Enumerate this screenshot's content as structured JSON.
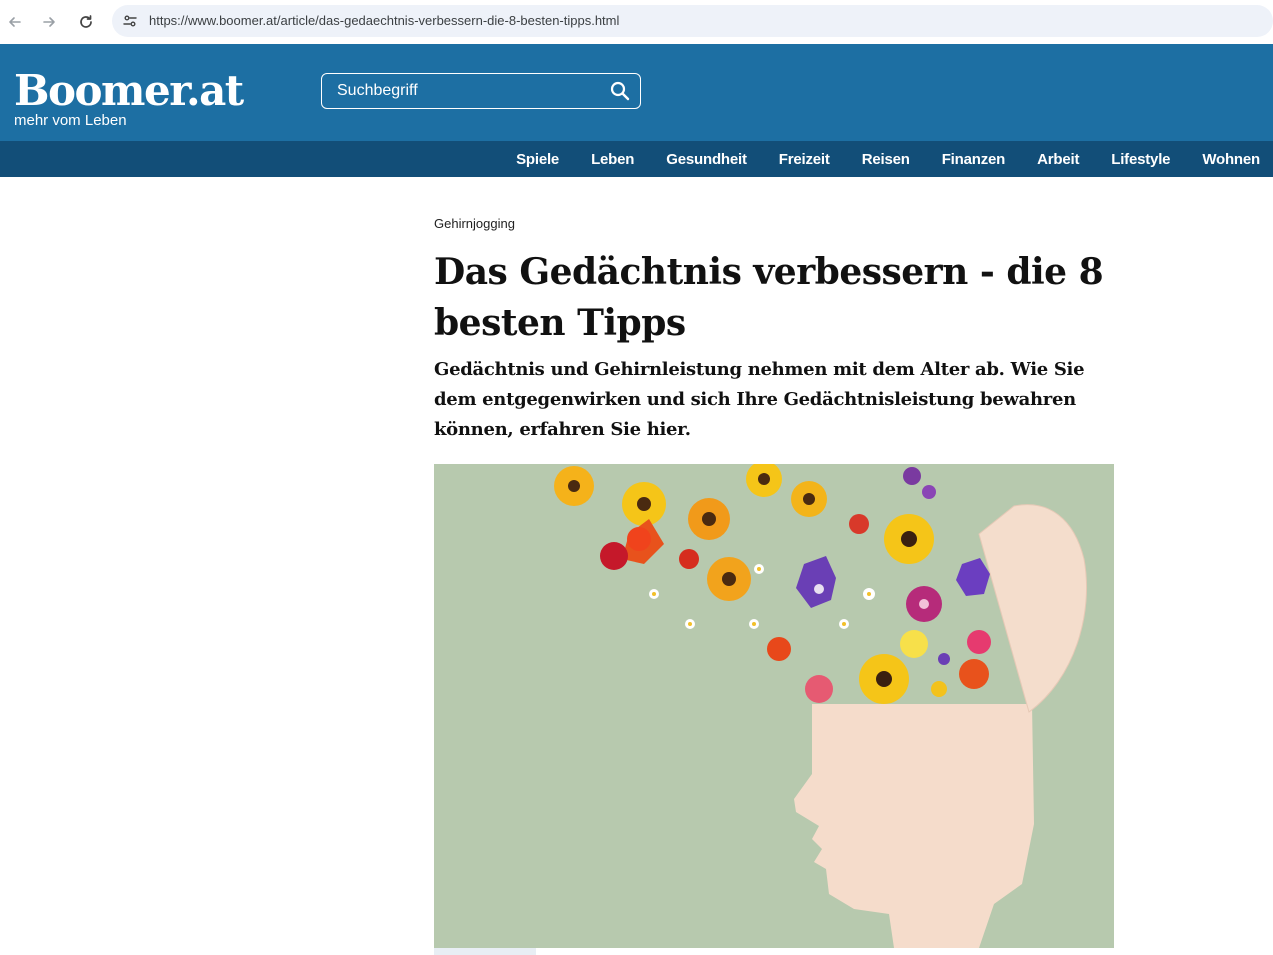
{
  "browser": {
    "url": "https://www.boomer.at/article/das-gedaechtnis-verbessern-die-8-besten-tipps.html",
    "icons": [
      "back-arrow-icon",
      "forward-arrow-icon",
      "reload-icon",
      "site-info-icon"
    ]
  },
  "header": {
    "logo": "Boomer.at",
    "tagline": "mehr vom Leben",
    "search_placeholder": "Suchbegriff",
    "brand_color": "#1d6fa3",
    "menu_color": "#124e78"
  },
  "nav": {
    "items": [
      {
        "label": "Spiele"
      },
      {
        "label": "Leben"
      },
      {
        "label": "Gesundheit"
      },
      {
        "label": "Freizeit"
      },
      {
        "label": "Reisen"
      },
      {
        "label": "Finanzen"
      },
      {
        "label": "Arbeit"
      },
      {
        "label": "Lifestyle"
      },
      {
        "label": "Wohnen"
      }
    ]
  },
  "article": {
    "kicker": "Gehirnjogging",
    "title": "Das Gedächtnis verbessern - die 8 besten Tipps",
    "lead": "Gedächtnis und Gehirnleistung nehmen mit dem Alter ab. Wie Sie dem entgegenwirken und sich Ihre Gedächtnisleistung bewahren können, erfahren Sie hier."
  }
}
